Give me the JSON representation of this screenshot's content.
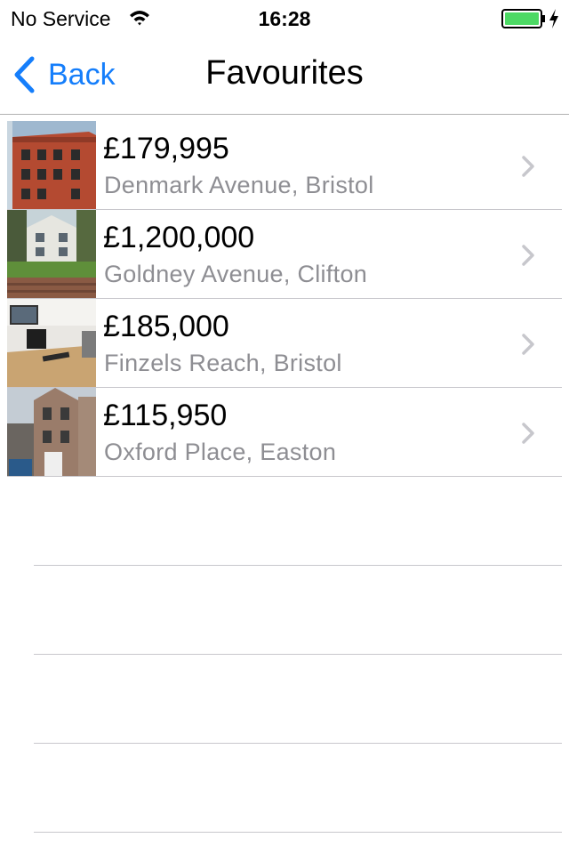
{
  "status_bar": {
    "carrier": "No Service",
    "time": "16:28",
    "icons": [
      "wifi-icon",
      "battery-icon",
      "charging-bolt-icon"
    ],
    "battery_color": "#4cd964"
  },
  "nav_bar": {
    "back_label": "Back",
    "title": "Favourites",
    "accent_color": "#157efb"
  },
  "favourites": [
    {
      "price": "£179,995",
      "address": "Denmark Avenue, Bristol",
      "thumbnail": "red-brick-building-photo"
    },
    {
      "price": "£1,200,000",
      "address": "Goldney Avenue, Clifton",
      "thumbnail": "house-with-garden-photo"
    },
    {
      "price": "£185,000",
      "address": "Finzels Reach, Bristol",
      "thumbnail": "interior-desk-photo"
    },
    {
      "price": "£115,950",
      "address": "Oxford Place, Easton",
      "thumbnail": "terraced-house-photo"
    }
  ]
}
